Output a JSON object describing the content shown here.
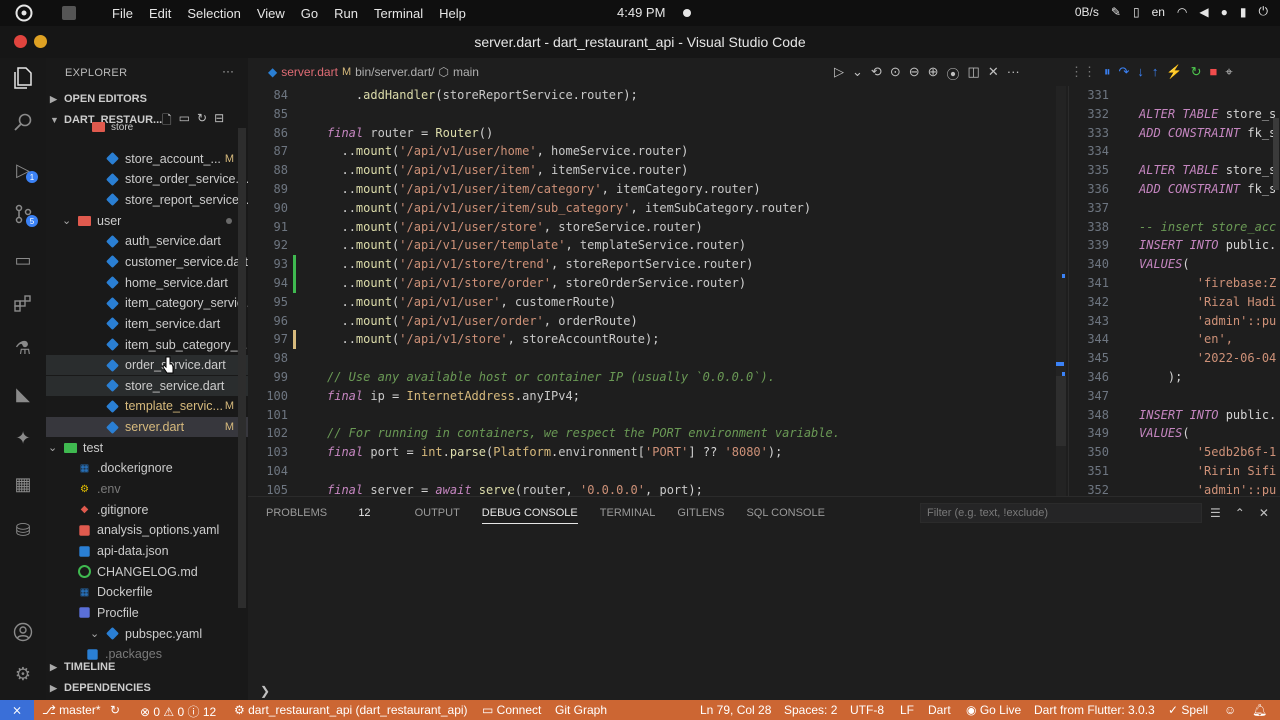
{
  "os": {
    "menus": [
      "File",
      "Edit",
      "Selection",
      "View",
      "Go",
      "Run",
      "Terminal",
      "Help"
    ],
    "clock": "4:49 PM",
    "net_speed": "0B/s",
    "lang": "en"
  },
  "window": {
    "title": "server.dart - dart_restaurant_api - Visual Studio Code"
  },
  "activity": {
    "scm_badge": "5",
    "debug_badge": "1"
  },
  "sidebar": {
    "title": "EXPLORER",
    "open_editors": "OPEN EDITORS",
    "project": "DART_RESTAUR...",
    "files": [
      {
        "name": "store",
        "kind": "folder-partial",
        "status": ""
      },
      {
        "name": "store_account_...",
        "kind": "dart",
        "status": "M"
      },
      {
        "name": "store_order_service.d...",
        "kind": "dart",
        "status": ""
      },
      {
        "name": "store_report_service....",
        "kind": "dart",
        "status": ""
      },
      {
        "name": "user",
        "kind": "folder",
        "status": ""
      },
      {
        "name": "auth_service.dart",
        "kind": "dart",
        "status": ""
      },
      {
        "name": "customer_service.dart",
        "kind": "dart",
        "status": ""
      },
      {
        "name": "home_service.dart",
        "kind": "dart",
        "status": ""
      },
      {
        "name": "item_category_servic...",
        "kind": "dart",
        "status": ""
      },
      {
        "name": "item_service.dart",
        "kind": "dart",
        "status": ""
      },
      {
        "name": "item_sub_category_s...",
        "kind": "dart",
        "status": ""
      },
      {
        "name": "order_service.dart",
        "kind": "dart",
        "status": ""
      },
      {
        "name": "store_service.dart",
        "kind": "dart",
        "status": ""
      },
      {
        "name": "template_servic...",
        "kind": "dart-mod",
        "status": "M"
      },
      {
        "name": "server.dart",
        "kind": "dart-mod",
        "status": "M"
      },
      {
        "name": "test",
        "kind": "folder-test",
        "status": ""
      },
      {
        "name": ".dockerignore",
        "kind": "docker",
        "status": ""
      },
      {
        "name": ".env",
        "kind": "env",
        "status": ""
      },
      {
        "name": ".gitignore",
        "kind": "git",
        "status": ""
      },
      {
        "name": "analysis_options.yaml",
        "kind": "yaml-red",
        "status": ""
      },
      {
        "name": "api-data.json",
        "kind": "json",
        "status": ""
      },
      {
        "name": "CHANGELOG.md",
        "kind": "md",
        "status": ""
      },
      {
        "name": "Dockerfile",
        "kind": "docker",
        "status": ""
      },
      {
        "name": "Procfile",
        "kind": "proc",
        "status": ""
      },
      {
        "name": "pubspec.yaml",
        "kind": "dart",
        "status": ""
      },
      {
        "name": ".packages",
        "kind": "file",
        "status": ""
      }
    ],
    "timeline": "TIMELINE",
    "dependencies": "DEPENDENCIES"
  },
  "editor": {
    "tab": "server.dart",
    "tab_status": "M",
    "breadcrumb_path": "bin/server.dart/",
    "breadcrumb_symbol": "main",
    "lines": [
      {
        "n": "84",
        "text": "    .addHandler(storeReportService.router);"
      },
      {
        "n": "85",
        "text": ""
      },
      {
        "n": "86",
        "text": "final router = Router()"
      },
      {
        "n": "87",
        "text": "  ..mount('/api/v1/user/home', homeService.router)"
      },
      {
        "n": "88",
        "text": "  ..mount('/api/v1/user/item', itemService.router)"
      },
      {
        "n": "89",
        "text": "  ..mount('/api/v1/user/item/category', itemCategory.router)"
      },
      {
        "n": "90",
        "text": "  ..mount('/api/v1/user/item/sub_category', itemSubCategory.router)"
      },
      {
        "n": "91",
        "text": "  ..mount('/api/v1/user/store', storeService.router)"
      },
      {
        "n": "92",
        "text": "  ..mount('/api/v1/user/template', templateService.router)"
      },
      {
        "n": "93",
        "text": "  ..mount('/api/v1/store/trend', storeReportService.router)"
      },
      {
        "n": "94",
        "text": "  ..mount('/api/v1/store/order', storeOrderService.router)"
      },
      {
        "n": "95",
        "text": "  ..mount('/api/v1/user', customerRoute)"
      },
      {
        "n": "96",
        "text": "  ..mount('/api/v1/user/order', orderRoute)"
      },
      {
        "n": "97",
        "text": "  ..mount('/api/v1/store', storeAccountRoute);"
      },
      {
        "n": "98",
        "text": ""
      },
      {
        "n": "99",
        "text": "// Use any available host or container IP (usually `0.0.0.0`)."
      },
      {
        "n": "100",
        "text": "final ip = InternetAddress.anyIPv4;"
      },
      {
        "n": "101",
        "text": ""
      },
      {
        "n": "102",
        "text": "// For running in containers, we respect the PORT environment variable."
      },
      {
        "n": "103",
        "text": "final port = int.parse(Platform.environment['PORT'] ?? '8080');"
      },
      {
        "n": "104",
        "text": ""
      },
      {
        "n": "105",
        "text": "final server = await serve(router, '0.0.0.0', port);"
      }
    ],
    "split_lines": [
      {
        "n": "331",
        "text": ""
      },
      {
        "n": "332",
        "text": "ALTER TABLE store_s"
      },
      {
        "n": "333",
        "text": "ADD CONSTRAINT fk_s"
      },
      {
        "n": "334",
        "text": ""
      },
      {
        "n": "335",
        "text": "ALTER TABLE store_s"
      },
      {
        "n": "336",
        "text": "ADD CONSTRAINT fk_s"
      },
      {
        "n": "337",
        "text": ""
      },
      {
        "n": "338",
        "text": "-- insert store_acc"
      },
      {
        "n": "339",
        "text": "INSERT INTO public."
      },
      {
        "n": "340",
        "text": "VALUES("
      },
      {
        "n": "341",
        "text": "        'firebase:Z"
      },
      {
        "n": "342",
        "text": "        'Rizal Hadi"
      },
      {
        "n": "343",
        "text": "        'admin'::pu"
      },
      {
        "n": "344",
        "text": "        'en',"
      },
      {
        "n": "345",
        "text": "        '2022-06-04"
      },
      {
        "n": "346",
        "text": "    );"
      },
      {
        "n": "347",
        "text": ""
      },
      {
        "n": "348",
        "text": "INSERT INTO public."
      },
      {
        "n": "349",
        "text": "VALUES("
      },
      {
        "n": "350",
        "text": "        '5edb2b6f-1"
      },
      {
        "n": "351",
        "text": "        'Ririn Sifi"
      },
      {
        "n": "352",
        "text": "        'admin'::pu"
      }
    ]
  },
  "panel": {
    "tabs": [
      "PROBLEMS",
      "OUTPUT",
      "DEBUG CONSOLE",
      "TERMINAL",
      "GITLENS",
      "SQL CONSOLE"
    ],
    "problems_count": "12",
    "active_tab": "DEBUG CONSOLE",
    "filter_placeholder": "Filter (e.g. text, !exclude)"
  },
  "status": {
    "branch": "master*",
    "errors": "0",
    "warnings": "0",
    "infos": "12",
    "launch": "dart_restaurant_api (dart_restaurant_api)",
    "connect": "Connect",
    "git_graph": "Git Graph",
    "position": "Ln 79, Col 28",
    "spaces": "Spaces: 2",
    "encoding": "UTF-8",
    "eol": "LF",
    "language": "Dart",
    "go_live": "Go Live",
    "flutter": "Dart from Flutter: 3.0.3",
    "spell": "Spell"
  },
  "colors": {
    "statusbar": "#cc6633",
    "keyword": "#c586c0",
    "string": "#ce9178",
    "function": "#dcdcaa",
    "comment": "#6a9955"
  }
}
